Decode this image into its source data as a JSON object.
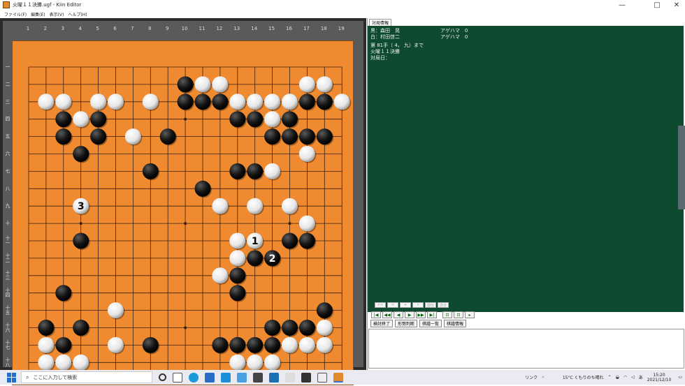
{
  "window": {
    "title": "火曜１１決勝.ugf - Kiin Editor",
    "min_glyph": "—",
    "max_glyph": "□",
    "close_glyph": "✕"
  },
  "menu": [
    "ファイル(F)",
    "編集(E)",
    "表示(V)",
    "ヘルプ(H)"
  ],
  "board": {
    "size": 19,
    "col_labels": [
      "1",
      "2",
      "3",
      "4",
      "5",
      "6",
      "7",
      "8",
      "9",
      "10",
      "11",
      "12",
      "13",
      "14",
      "15",
      "16",
      "17",
      "18",
      "19"
    ],
    "row_labels": [
      "一",
      "二",
      "三",
      "四",
      "五",
      "六",
      "七",
      "八",
      "九",
      "十",
      "十一",
      "十二",
      "十三",
      "十四",
      "十五",
      "十六",
      "十七",
      "十八",
      "十九"
    ],
    "stones": [
      {
        "c": "B",
        "x": 10,
        "y": 2
      },
      {
        "c": "W",
        "x": 11,
        "y": 2
      },
      {
        "c": "W",
        "x": 12,
        "y": 2
      },
      {
        "c": "W",
        "x": 17,
        "y": 2
      },
      {
        "c": "W",
        "x": 18,
        "y": 2
      },
      {
        "c": "W",
        "x": 2,
        "y": 3
      },
      {
        "c": "W",
        "x": 3,
        "y": 3
      },
      {
        "c": "W",
        "x": 5,
        "y": 3
      },
      {
        "c": "W",
        "x": 6,
        "y": 3
      },
      {
        "c": "W",
        "x": 8,
        "y": 3
      },
      {
        "c": "B",
        "x": 10,
        "y": 3
      },
      {
        "c": "B",
        "x": 11,
        "y": 3
      },
      {
        "c": "B",
        "x": 12,
        "y": 3
      },
      {
        "c": "W",
        "x": 13,
        "y": 3
      },
      {
        "c": "W",
        "x": 14,
        "y": 3
      },
      {
        "c": "W",
        "x": 15,
        "y": 3
      },
      {
        "c": "W",
        "x": 16,
        "y": 3
      },
      {
        "c": "B",
        "x": 17,
        "y": 3
      },
      {
        "c": "B",
        "x": 18,
        "y": 3
      },
      {
        "c": "W",
        "x": 19,
        "y": 3
      },
      {
        "c": "B",
        "x": 3,
        "y": 4
      },
      {
        "c": "W",
        "x": 4,
        "y": 4
      },
      {
        "c": "B",
        "x": 5,
        "y": 4
      },
      {
        "c": "B",
        "x": 13,
        "y": 4
      },
      {
        "c": "B",
        "x": 14,
        "y": 4
      },
      {
        "c": "W",
        "x": 15,
        "y": 4
      },
      {
        "c": "B",
        "x": 16,
        "y": 4
      },
      {
        "c": "B",
        "x": 3,
        "y": 5
      },
      {
        "c": "B",
        "x": 5,
        "y": 5
      },
      {
        "c": "W",
        "x": 7,
        "y": 5
      },
      {
        "c": "B",
        "x": 9,
        "y": 5
      },
      {
        "c": "B",
        "x": 15,
        "y": 5
      },
      {
        "c": "B",
        "x": 16,
        "y": 5
      },
      {
        "c": "B",
        "x": 17,
        "y": 5
      },
      {
        "c": "B",
        "x": 18,
        "y": 5
      },
      {
        "c": "B",
        "x": 4,
        "y": 6
      },
      {
        "c": "W",
        "x": 17,
        "y": 6
      },
      {
        "c": "B",
        "x": 8,
        "y": 7
      },
      {
        "c": "B",
        "x": 13,
        "y": 7
      },
      {
        "c": "B",
        "x": 14,
        "y": 7
      },
      {
        "c": "W",
        "x": 15,
        "y": 7
      },
      {
        "c": "B",
        "x": 11,
        "y": 8
      },
      {
        "c": "W",
        "x": 4,
        "y": 9,
        "n": "3"
      },
      {
        "c": "W",
        "x": 12,
        "y": 9
      },
      {
        "c": "W",
        "x": 14,
        "y": 9
      },
      {
        "c": "W",
        "x": 16,
        "y": 9
      },
      {
        "c": "W",
        "x": 17,
        "y": 10
      },
      {
        "c": "B",
        "x": 4,
        "y": 11
      },
      {
        "c": "W",
        "x": 13,
        "y": 11
      },
      {
        "c": "W",
        "x": 14,
        "y": 11,
        "n": "1"
      },
      {
        "c": "B",
        "x": 16,
        "y": 11
      },
      {
        "c": "B",
        "x": 17,
        "y": 11
      },
      {
        "c": "W",
        "x": 13,
        "y": 12
      },
      {
        "c": "B",
        "x": 14,
        "y": 12
      },
      {
        "c": "B",
        "x": 15,
        "y": 12,
        "n": "2"
      },
      {
        "c": "W",
        "x": 12,
        "y": 13
      },
      {
        "c": "B",
        "x": 13,
        "y": 13
      },
      {
        "c": "B",
        "x": 3,
        "y": 14
      },
      {
        "c": "B",
        "x": 13,
        "y": 14
      },
      {
        "c": "W",
        "x": 6,
        "y": 15
      },
      {
        "c": "B",
        "x": 18,
        "y": 15
      },
      {
        "c": "B",
        "x": 2,
        "y": 16
      },
      {
        "c": "B",
        "x": 4,
        "y": 16
      },
      {
        "c": "B",
        "x": 15,
        "y": 16
      },
      {
        "c": "B",
        "x": 16,
        "y": 16
      },
      {
        "c": "B",
        "x": 17,
        "y": 16
      },
      {
        "c": "W",
        "x": 18,
        "y": 16
      },
      {
        "c": "W",
        "x": 2,
        "y": 17
      },
      {
        "c": "B",
        "x": 3,
        "y": 17
      },
      {
        "c": "W",
        "x": 6,
        "y": 17
      },
      {
        "c": "B",
        "x": 8,
        "y": 17
      },
      {
        "c": "B",
        "x": 12,
        "y": 17
      },
      {
        "c": "B",
        "x": 13,
        "y": 17
      },
      {
        "c": "B",
        "x": 14,
        "y": 17
      },
      {
        "c": "B",
        "x": 15,
        "y": 17
      },
      {
        "c": "W",
        "x": 16,
        "y": 17
      },
      {
        "c": "W",
        "x": 17,
        "y": 17
      },
      {
        "c": "W",
        "x": 18,
        "y": 17
      },
      {
        "c": "W",
        "x": 2,
        "y": 18
      },
      {
        "c": "W",
        "x": 3,
        "y": 18
      },
      {
        "c": "W",
        "x": 4,
        "y": 18
      },
      {
        "c": "W",
        "x": 13,
        "y": 18
      },
      {
        "c": "W",
        "x": 14,
        "y": 18
      },
      {
        "c": "W",
        "x": 15,
        "y": 18
      }
    ],
    "star_points": [
      [
        4,
        4
      ],
      [
        10,
        4
      ],
      [
        16,
        4
      ],
      [
        4,
        10
      ],
      [
        10,
        10
      ],
      [
        16,
        10
      ],
      [
        4,
        16
      ],
      [
        10,
        16
      ],
      [
        16,
        16
      ]
    ]
  },
  "info": {
    "tab": "対局情報",
    "black_label": "黒：森田　晃",
    "black_agehama": "アゲハマ　0",
    "white_label": "白：村田啓二",
    "white_agehama": "アゲハマ　0",
    "move_text": "第 81手（ 4， 九）まで",
    "event": "火曜１１決勝",
    "date_label": "対局日："
  },
  "nav_dim": [
    "<<",
    "<",
    "+",
    "»",
    "前分",
    "次分"
  ],
  "nav": [
    "|◀",
    "◀◀",
    "◀",
    "▶",
    "▶▶",
    "▶|",
    "⊡",
    "⊡",
    "▸"
  ],
  "actions": [
    "検討終了",
    "形勢判断",
    "棋譜一覧",
    "棋譜情報"
  ],
  "taskbar": {
    "search_placeholder": "ここに入力して検索",
    "link_label": "リンク",
    "weather": "15°C くもりのち晴れ",
    "ime": "あ",
    "time": "15:20",
    "date": "2021/12/10"
  }
}
